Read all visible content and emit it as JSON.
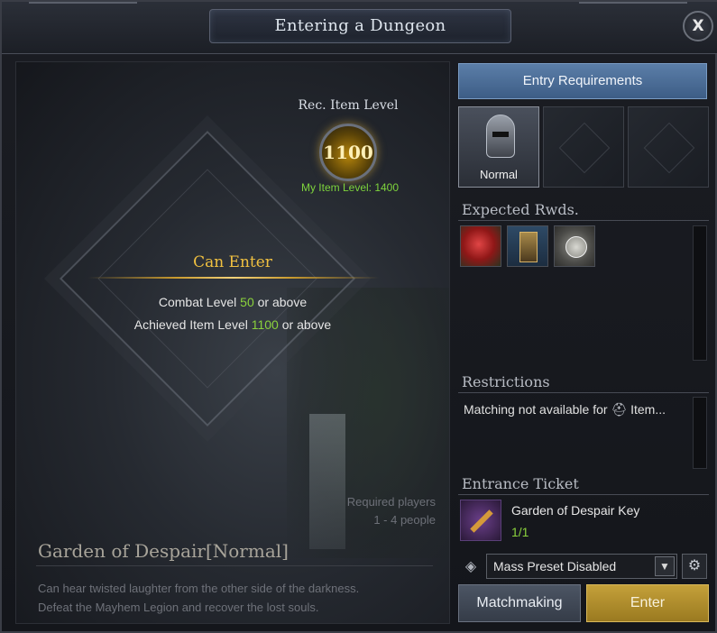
{
  "window": {
    "title": "Entering a Dungeon",
    "close_label": "X"
  },
  "item_level": {
    "label": "Rec. Item Level",
    "value": "1100",
    "my_level": "My Item Level: 1400"
  },
  "status": {
    "can_enter": "Can Enter",
    "req1_prefix": "Combat Level ",
    "req1_value": "50",
    "req1_suffix": " or above",
    "req2_prefix": "Achieved Item Level ",
    "req2_value": "1100",
    "req2_suffix": " or above"
  },
  "players": {
    "label": "Required players",
    "value": "1 - 4 people"
  },
  "dungeon": {
    "name": "Garden of Despair[Normal]",
    "desc_line1": "Can hear twisted laughter from the other side of the darkness.",
    "desc_line2": "Defeat the Mayhem Legion and recover the lost souls."
  },
  "sidebar": {
    "entry_requirements": "Entry Requirements",
    "difficulty_selected": "Normal",
    "expected_rewards_title": "Expected Rwds.",
    "rewards": [
      "red-orb-icon",
      "card-pack-icon",
      "silver-coins-icon"
    ],
    "restrictions_title": "Restrictions",
    "restriction_prefix": "Matching not available for ",
    "restriction_icon": "helmet-icon",
    "restriction_suffix": " Item...",
    "ticket_title": "Entrance Ticket",
    "ticket_name": "Garden of Despair Key",
    "ticket_count": "1/1",
    "preset_label": "Mass Preset Disabled",
    "matchmaking": "Matchmaking",
    "enter": "Enter"
  },
  "colors": {
    "accent_gold": "#f0c040",
    "accent_green": "#8ad13c",
    "tab_blue": "#4a6e98",
    "enter_gold": "#b08a2a"
  }
}
